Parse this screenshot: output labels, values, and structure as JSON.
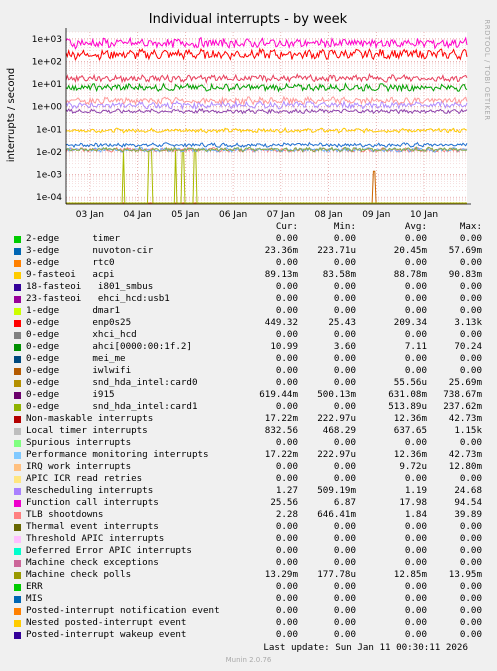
{
  "chart_data": {
    "type": "line",
    "title": "Individual interrupts - by week",
    "ylabel": "interrupts / second",
    "side_label": "RRDTOOL / TOBI OETIKER",
    "y_scale": "log",
    "ylim": [
      5e-05,
      2000
    ],
    "y_ticks": [
      "1e+03",
      "1e+02",
      "1e+01",
      "1e+00",
      "1e-01",
      "1e-02",
      "1e-03",
      "1e-04"
    ],
    "y_tick_values": [
      1000,
      100,
      10,
      1,
      0.1,
      0.01,
      0.001,
      0.0001
    ],
    "x_ticks": [
      "03 Jan",
      "04 Jan",
      "05 Jan",
      "06 Jan",
      "07 Jan",
      "08 Jan",
      "09 Jan",
      "10 Jan"
    ],
    "xlim_days": [
      2.5,
      10.9
    ],
    "series": [
      {
        "name": "3-edge nuvoton-cir",
        "color": "#1f6fd0",
        "level": 0.0204
      },
      {
        "name": "9-fasteoi acpi",
        "color": "#ffcc00",
        "level": 0.0888
      },
      {
        "name": "0-edge enp0s25",
        "color": "#ff0000",
        "level": 209.34
      },
      {
        "name": "0-edge ahci[0000:00:1f.2]",
        "color": "#00a000",
        "level": 7.11
      },
      {
        "name": "0-edge snd_hda_intel:card0",
        "color": "#cc6600",
        "level": 5.56e-05,
        "spikes": [
          8.95
        ]
      },
      {
        "name": "0-edge i915",
        "color": "#8e44ad",
        "level": 0.631
      },
      {
        "name": "0-edge snd_hda_intel:card1",
        "color": "#aabb00",
        "level": 0.000514,
        "spikes": [
          3.7,
          4.25,
          4.3,
          4.8,
          4.95,
          5.2
        ]
      },
      {
        "name": "Non-maskable interrupts",
        "color": "#ff8080",
        "level": 0.0124
      },
      {
        "name": "Local timer interrupts",
        "color": "#ff00cc",
        "level": 637.65
      },
      {
        "name": "Performance monitoring interrupts",
        "color": "#70b0ff",
        "level": 0.0124
      },
      {
        "name": "IRQ work interrupts",
        "color": "#ffb070",
        "level": 9.7e-06
      },
      {
        "name": "Rescheduling interrupts",
        "color": "#b08cff",
        "level": 1.19
      },
      {
        "name": "Function call interrupts",
        "color": "#e8405c",
        "level": 17.98
      },
      {
        "name": "TLB shootdowns",
        "color": "#ff9999",
        "level": 1.84
      },
      {
        "name": "Machine check polls",
        "color": "#88aa44",
        "level": 0.01285
      }
    ]
  },
  "legend": {
    "headers": [
      "Cur:",
      "Min:",
      "Avg:",
      "Max:"
    ],
    "rows": [
      {
        "name": "2-edge      timer",
        "color": "#00cc00",
        "cur": "0.00",
        "min": "0.00",
        "avg": "0.00",
        "max": "0.00"
      },
      {
        "name": "3-edge      nuvoton-cir",
        "color": "#0066b3",
        "cur": "23.36m",
        "min": "223.71u",
        "avg": "20.45m",
        "max": "57.69m"
      },
      {
        "name": "8-edge      rtc0",
        "color": "#ff8000",
        "cur": "0.00",
        "min": "0.00",
        "avg": "0.00",
        "max": "0.00"
      },
      {
        "name": "9-fasteoi   acpi",
        "color": "#ffcc00",
        "cur": "89.13m",
        "min": "83.58m",
        "avg": "88.78m",
        "max": "90.83m"
      },
      {
        "name": "18-fasteoi   i801_smbus",
        "color": "#330099",
        "cur": "0.00",
        "min": "0.00",
        "avg": "0.00",
        "max": "0.00"
      },
      {
        "name": "23-fasteoi   ehci_hcd:usb1",
        "color": "#990099",
        "cur": "0.00",
        "min": "0.00",
        "avg": "0.00",
        "max": "0.00"
      },
      {
        "name": "1-edge      dmar1",
        "color": "#ccff00",
        "cur": "0.00",
        "min": "0.00",
        "avg": "0.00",
        "max": "0.00"
      },
      {
        "name": "0-edge      enp0s25",
        "color": "#ff0000",
        "cur": "449.32",
        "min": "25.43",
        "avg": "209.34",
        "max": "3.13k"
      },
      {
        "name": "0-edge      xhci_hcd",
        "color": "#808080",
        "cur": "0.00",
        "min": "0.00",
        "avg": "0.00",
        "max": "0.00"
      },
      {
        "name": "0-edge      ahci[0000:00:1f.2]",
        "color": "#008f00",
        "cur": "10.99",
        "min": "3.60",
        "avg": "7.11",
        "max": "70.24"
      },
      {
        "name": "0-edge      mei_me",
        "color": "#00487d",
        "cur": "0.00",
        "min": "0.00",
        "avg": "0.00",
        "max": "0.00"
      },
      {
        "name": "0-edge      iwlwifi",
        "color": "#b35a00",
        "cur": "0.00",
        "min": "0.00",
        "avg": "0.00",
        "max": "0.00"
      },
      {
        "name": "0-edge      snd_hda_intel:card0",
        "color": "#b38f00",
        "cur": "0.00",
        "min": "0.00",
        "avg": "55.56u",
        "max": "25.69m"
      },
      {
        "name": "0-edge      i915",
        "color": "#6b006b",
        "cur": "619.44m",
        "min": "500.13m",
        "avg": "631.08m",
        "max": "738.67m"
      },
      {
        "name": "0-edge      snd_hda_intel:card1",
        "color": "#8fb300",
        "cur": "0.00",
        "min": "0.00",
        "avg": "513.89u",
        "max": "237.62m"
      },
      {
        "name": "Non-maskable interrupts",
        "color": "#b30000",
        "cur": "17.22m",
        "min": "222.97u",
        "avg": "12.36m",
        "max": "42.73m"
      },
      {
        "name": "Local timer interrupts",
        "color": "#bebebe",
        "cur": "832.56",
        "min": "468.29",
        "avg": "637.65",
        "max": "1.15k"
      },
      {
        "name": "Spurious interrupts",
        "color": "#80ff80",
        "cur": "0.00",
        "min": "0.00",
        "avg": "0.00",
        "max": "0.00"
      },
      {
        "name": "Performance monitoring interrupts",
        "color": "#80c9ff",
        "cur": "17.22m",
        "min": "222.97u",
        "avg": "12.36m",
        "max": "42.73m"
      },
      {
        "name": "IRQ work interrupts",
        "color": "#ffc080",
        "cur": "0.00",
        "min": "0.00",
        "avg": "9.72u",
        "max": "12.80m"
      },
      {
        "name": "APIC ICR read retries",
        "color": "#ffe680",
        "cur": "0.00",
        "min": "0.00",
        "avg": "0.00",
        "max": "0.00"
      },
      {
        "name": "Rescheduling interrupts",
        "color": "#aa80ff",
        "cur": "1.27",
        "min": "509.19m",
        "avg": "1.19",
        "max": "24.68"
      },
      {
        "name": "Function call interrupts",
        "color": "#ee00cc",
        "cur": "25.56",
        "min": "6.87",
        "avg": "17.98",
        "max": "94.54"
      },
      {
        "name": "TLB shootdowns",
        "color": "#ff8080",
        "cur": "2.28",
        "min": "646.41m",
        "avg": "1.84",
        "max": "39.89"
      },
      {
        "name": "Thermal event interrupts",
        "color": "#666600",
        "cur": "0.00",
        "min": "0.00",
        "avg": "0.00",
        "max": "0.00"
      },
      {
        "name": "Threshold APIC interrupts",
        "color": "#ffbfff",
        "cur": "0.00",
        "min": "0.00",
        "avg": "0.00",
        "max": "0.00"
      },
      {
        "name": "Deferred Error APIC interrupts",
        "color": "#00ffcc",
        "cur": "0.00",
        "min": "0.00",
        "avg": "0.00",
        "max": "0.00"
      },
      {
        "name": "Machine check exceptions",
        "color": "#cc6699",
        "cur": "0.00",
        "min": "0.00",
        "avg": "0.00",
        "max": "0.00"
      },
      {
        "name": "Machine check polls",
        "color": "#999900",
        "cur": "13.29m",
        "min": "177.78u",
        "avg": "12.85m",
        "max": "13.95m"
      },
      {
        "name": "ERR",
        "color": "#00cc00",
        "cur": "0.00",
        "min": "0.00",
        "avg": "0.00",
        "max": "0.00"
      },
      {
        "name": "MIS",
        "color": "#0066b3",
        "cur": "0.00",
        "min": "0.00",
        "avg": "0.00",
        "max": "0.00"
      },
      {
        "name": "Posted-interrupt notification event",
        "color": "#ff8000",
        "cur": "0.00",
        "min": "0.00",
        "avg": "0.00",
        "max": "0.00"
      },
      {
        "name": "Nested posted-interrupt event",
        "color": "#ffcc00",
        "cur": "0.00",
        "min": "0.00",
        "avg": "0.00",
        "max": "0.00"
      },
      {
        "name": "Posted-interrupt wakeup event",
        "color": "#330099",
        "cur": "0.00",
        "min": "0.00",
        "avg": "0.00",
        "max": "0.00"
      }
    ]
  },
  "footer": {
    "last_update": "Last update: Sun Jan 11 00:30:11 2026",
    "munin": "Munin 2.0.76"
  }
}
